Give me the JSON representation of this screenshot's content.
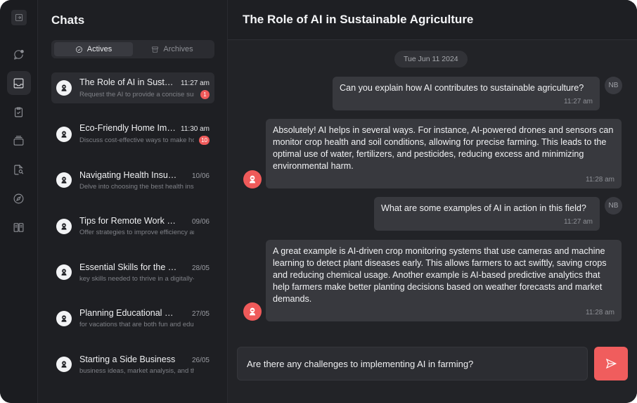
{
  "colors": {
    "accent": "#f05d5d",
    "background": "#1e1f23",
    "bubble": "#38393e"
  },
  "rail": {
    "icons": [
      "sidebar-toggle-icon",
      "new-chat-icon",
      "inbox-icon",
      "clipboard-check-icon",
      "archive-icon",
      "document-search-icon",
      "compass-icon",
      "book-icon"
    ]
  },
  "sidebar": {
    "title": "Chats",
    "tabs": [
      {
        "label": "Actives",
        "icon": "check-circle-icon"
      },
      {
        "label": "Archives",
        "icon": "archive-box-icon"
      }
    ],
    "chats": [
      {
        "name": "The Role of AI in Sustainable Agriculture",
        "time": "11:27 am",
        "preview": "Request the AI to provide a concise summary",
        "badge": "1"
      },
      {
        "name": "Eco-Friendly Home Improvements",
        "time": "11:30 am",
        "preview": "Discuss cost-effective ways to make homes greener",
        "badge": "10"
      },
      {
        "name": "Navigating Health Insurance",
        "time": "10/06",
        "preview": "Delve into choosing the best health insurance plan",
        "badge": ""
      },
      {
        "name": "Tips for Remote Work Productivity",
        "time": "09/06",
        "preview": "Offer strategies to improve efficiency and focus",
        "badge": ""
      },
      {
        "name": "Essential Skills for the Digital Age",
        "time": "28/05",
        "preview": "key skills needed to thrive in a digitally-driven world",
        "badge": ""
      },
      {
        "name": "Planning Educational Family Trips",
        "time": "27/05",
        "preview": "for vacations that are both fun and educational",
        "badge": ""
      },
      {
        "name": "Starting a Side Business",
        "time": "26/05",
        "preview": "business ideas, market analysis, and the basics",
        "badge": ""
      }
    ]
  },
  "conversation": {
    "title": "The Role of AI in Sustainable Agriculture",
    "date": "Tue Jun 11 2024",
    "user_initials": "NB",
    "messages": [
      {
        "role": "user",
        "text": "Can you explain how AI contributes to sustainable agriculture?",
        "time": "11:27 am"
      },
      {
        "role": "assistant",
        "text": "Absolutely! AI helps in several ways. For instance, AI-powered drones and sensors can monitor crop health and soil conditions, allowing for precise farming. This leads to the optimal use of water, fertilizers, and pesticides, reducing excess and minimizing environmental harm.",
        "time": "11:28 am"
      },
      {
        "role": "user",
        "text": "What are some examples of AI in action in this field?",
        "time": "11:27 am"
      },
      {
        "role": "assistant",
        "text": "A great example is AI-driven crop monitoring systems that use cameras and machine learning to detect plant diseases early. This allows farmers to act swiftly, saving crops and reducing chemical usage. Another example is AI-based predictive analytics that help farmers make better planting decisions based on weather forecasts and market demands.",
        "time": "11:28 am"
      }
    ]
  },
  "composer": {
    "value": "Are there any challenges to implementing AI in farming?",
    "send_icon": "send-icon"
  }
}
